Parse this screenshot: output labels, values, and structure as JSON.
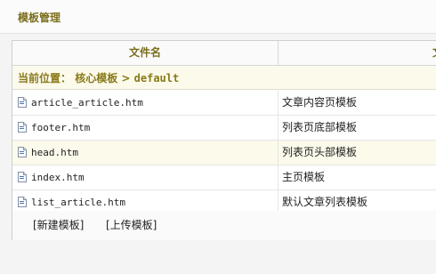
{
  "header": {
    "title": "模板管理"
  },
  "table": {
    "col_filename": "文件名",
    "col_desc_partial": "文"
  },
  "location": {
    "label": "当前位置：",
    "path_root": "核心模板",
    "separator": ">",
    "path_current": "default"
  },
  "files": [
    {
      "name": "article_article.htm",
      "desc": "文章内容页模板",
      "icon": "file-icon"
    },
    {
      "name": "footer.htm",
      "desc": "列表页底部模板",
      "icon": "file-icon"
    },
    {
      "name": "head.htm",
      "desc": "列表页头部模板",
      "icon": "file-icon"
    },
    {
      "name": "index.htm",
      "desc": "主页模板",
      "icon": "file-icon"
    },
    {
      "name": "list_article.htm",
      "desc": "默认文章列表模板",
      "icon": "file-icon"
    }
  ],
  "actions": {
    "new_template": "[新建模板]",
    "upload_template": "[上传模板]"
  },
  "colors": {
    "accent_text": "#7a6e1c",
    "alt_row": "#fbfaeb"
  }
}
